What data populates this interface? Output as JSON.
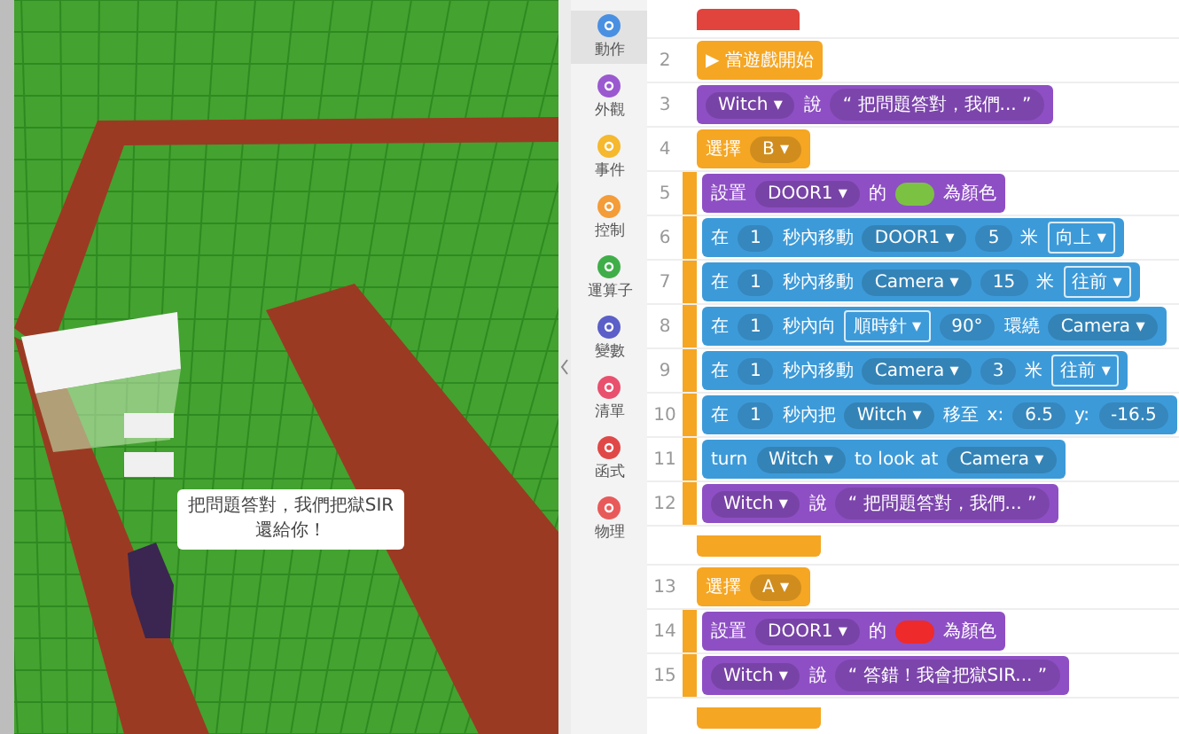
{
  "scene": {
    "speech_bubble": "把問題答對，我們把獄SIR還給你！"
  },
  "categories": [
    {
      "label": "動作",
      "color": "#4a90e2",
      "selected": true
    },
    {
      "label": "外觀",
      "color": "#9b59d0",
      "selected": false
    },
    {
      "label": "事件",
      "color": "#f5b82e",
      "selected": false
    },
    {
      "label": "控制",
      "color": "#f39c38",
      "selected": false
    },
    {
      "label": "運算子",
      "color": "#3fae49",
      "selected": false
    },
    {
      "label": "變數",
      "color": "#5b5fc7",
      "selected": false
    },
    {
      "label": "清單",
      "color": "#e8506e",
      "selected": false
    },
    {
      "label": "函式",
      "color": "#e04848",
      "selected": false
    },
    {
      "label": "物理",
      "color": "#e85a5a",
      "selected": false
    }
  ],
  "lines": [
    {
      "kind": "stub",
      "inside": false
    },
    {
      "number": "2",
      "kind": "hat",
      "inside": false,
      "parts": [
        {
          "kind": "text",
          "text": "▶ 當遊戲開始"
        }
      ]
    },
    {
      "number": "3",
      "kind": "looks",
      "inside": false,
      "parts": [
        {
          "kind": "dropdown",
          "text": "Witch ▾"
        },
        {
          "kind": "text",
          "text": "說"
        },
        {
          "kind": "value",
          "text": "“ 把問題答對，我們... ”"
        }
      ]
    },
    {
      "number": "4",
      "kind": "control",
      "inside": false,
      "parts": [
        {
          "kind": "text",
          "text": "選擇"
        },
        {
          "kind": "dropdown",
          "text": "B ▾"
        }
      ]
    },
    {
      "number": "5",
      "kind": "looks",
      "inside": true,
      "parts": [
        {
          "kind": "text",
          "text": "設置"
        },
        {
          "kind": "dropdown",
          "text": "DOOR1 ▾"
        },
        {
          "kind": "text",
          "text": "的"
        },
        {
          "kind": "swatch",
          "color": "#7cc242"
        },
        {
          "kind": "text",
          "text": "為顏色"
        }
      ]
    },
    {
      "number": "6",
      "kind": "motion",
      "inside": true,
      "parts": [
        {
          "kind": "text",
          "text": "在"
        },
        {
          "kind": "value",
          "text": "1"
        },
        {
          "kind": "text",
          "text": "秒內移動"
        },
        {
          "kind": "dropdown",
          "text": "DOOR1 ▾"
        },
        {
          "kind": "value",
          "text": "5"
        },
        {
          "kind": "text",
          "text": "米"
        },
        {
          "kind": "menu",
          "text": "向上 ▾"
        }
      ]
    },
    {
      "number": "7",
      "kind": "motion",
      "inside": true,
      "parts": [
        {
          "kind": "text",
          "text": "在"
        },
        {
          "kind": "value",
          "text": "1"
        },
        {
          "kind": "text",
          "text": "秒內移動"
        },
        {
          "kind": "dropdown",
          "text": "Camera ▾"
        },
        {
          "kind": "value",
          "text": "15"
        },
        {
          "kind": "text",
          "text": "米"
        },
        {
          "kind": "menu",
          "text": "往前 ▾"
        }
      ]
    },
    {
      "number": "8",
      "kind": "motion",
      "inside": true,
      "parts": [
        {
          "kind": "text",
          "text": "在"
        },
        {
          "kind": "value",
          "text": "1"
        },
        {
          "kind": "text",
          "text": "秒內向"
        },
        {
          "kind": "menu",
          "text": "順時針 ▾"
        },
        {
          "kind": "value",
          "text": "90°"
        },
        {
          "kind": "text",
          "text": "環繞"
        },
        {
          "kind": "dropdown",
          "text": "Camera ▾"
        }
      ]
    },
    {
      "number": "9",
      "kind": "motion",
      "inside": true,
      "parts": [
        {
          "kind": "text",
          "text": "在"
        },
        {
          "kind": "value",
          "text": "1"
        },
        {
          "kind": "text",
          "text": "秒內移動"
        },
        {
          "kind": "dropdown",
          "text": "Camera ▾"
        },
        {
          "kind": "value",
          "text": "3"
        },
        {
          "kind": "text",
          "text": "米"
        },
        {
          "kind": "menu",
          "text": "往前 ▾"
        }
      ]
    },
    {
      "number": "10",
      "kind": "motion",
      "inside": true,
      "parts": [
        {
          "kind": "text",
          "text": "在"
        },
        {
          "kind": "value",
          "text": "1"
        },
        {
          "kind": "text",
          "text": "秒內把"
        },
        {
          "kind": "dropdown",
          "text": "Witch ▾"
        },
        {
          "kind": "text",
          "text": "移至"
        },
        {
          "kind": "text",
          "text": "x:"
        },
        {
          "kind": "value",
          "text": "6.5"
        },
        {
          "kind": "text",
          "text": "y:"
        },
        {
          "kind": "value",
          "text": "-16.5"
        }
      ]
    },
    {
      "number": "11",
      "kind": "motion",
      "inside": true,
      "parts": [
        {
          "kind": "text",
          "text": "turn"
        },
        {
          "kind": "dropdown",
          "text": "Witch ▾"
        },
        {
          "kind": "text",
          "text": "to look at"
        },
        {
          "kind": "dropdown",
          "text": "Camera ▾"
        }
      ]
    },
    {
      "number": "12",
      "kind": "looks",
      "inside": true,
      "parts": [
        {
          "kind": "dropdown",
          "text": "Witch ▾"
        },
        {
          "kind": "text",
          "text": "說"
        },
        {
          "kind": "value",
          "text": "“ 把問題答對，我們... ”"
        }
      ]
    },
    {
      "kind": "end",
      "inside": false
    },
    {
      "number": "13",
      "kind": "control",
      "inside": false,
      "parts": [
        {
          "kind": "text",
          "text": "選擇"
        },
        {
          "kind": "dropdown",
          "text": "A ▾"
        }
      ]
    },
    {
      "number": "14",
      "kind": "looks",
      "inside": true,
      "parts": [
        {
          "kind": "text",
          "text": "設置"
        },
        {
          "kind": "dropdown",
          "text": "DOOR1 ▾"
        },
        {
          "kind": "text",
          "text": "的"
        },
        {
          "kind": "swatch",
          "color": "#ee2a2a"
        },
        {
          "kind": "text",
          "text": "為顏色"
        }
      ]
    },
    {
      "number": "15",
      "kind": "looks",
      "inside": true,
      "parts": [
        {
          "kind": "dropdown",
          "text": "Witch ▾"
        },
        {
          "kind": "text",
          "text": "說"
        },
        {
          "kind": "value",
          "text": "“ 答錯！我會把獄SIR... ”"
        }
      ]
    },
    {
      "kind": "end",
      "inside": false
    }
  ]
}
